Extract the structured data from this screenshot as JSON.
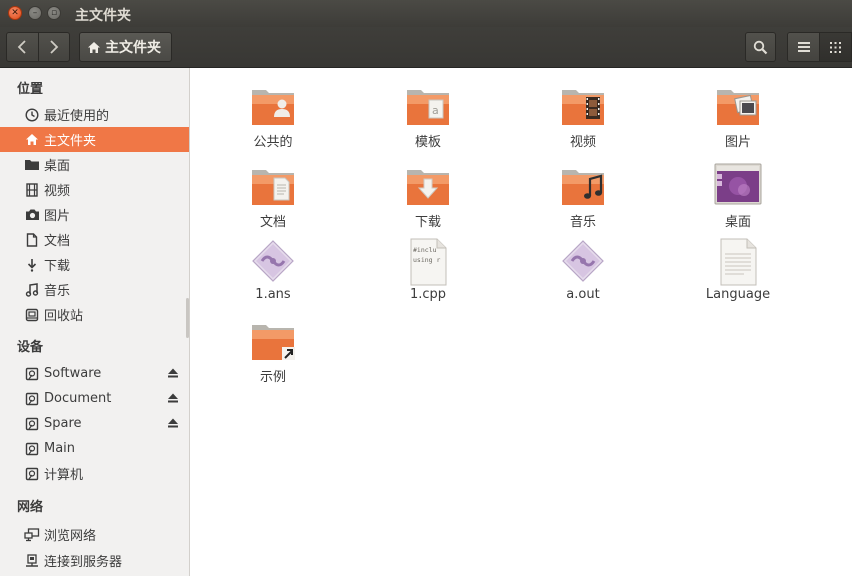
{
  "window": {
    "title": "主文件夹"
  },
  "toolbar": {
    "path_label": "主文件夹"
  },
  "sidebar": {
    "sections": [
      {
        "heading": "位置"
      },
      {
        "heading": "设备"
      },
      {
        "heading": "网络"
      }
    ],
    "places": [
      {
        "label": "最近使用的",
        "icon": "clock-icon"
      },
      {
        "label": "主文件夹",
        "icon": "home-icon"
      },
      {
        "label": "桌面",
        "icon": "desktop-folder-icon"
      },
      {
        "label": "视频",
        "icon": "film-icon"
      },
      {
        "label": "图片",
        "icon": "camera-icon"
      },
      {
        "label": "文档",
        "icon": "document-icon"
      },
      {
        "label": "下载",
        "icon": "download-icon"
      },
      {
        "label": "音乐",
        "icon": "music-icon"
      },
      {
        "label": "回收站",
        "icon": "trash-icon"
      }
    ],
    "devices": [
      {
        "label": "Software",
        "icon": "drive-icon",
        "ejectable": true
      },
      {
        "label": "Document",
        "icon": "drive-icon",
        "ejectable": true
      },
      {
        "label": "Spare",
        "icon": "drive-icon",
        "ejectable": true
      },
      {
        "label": "Main",
        "icon": "drive-icon",
        "ejectable": false
      },
      {
        "label": "计算机",
        "icon": "drive-icon",
        "ejectable": false
      }
    ],
    "network": [
      {
        "label": "浏览网络",
        "icon": "network-icon"
      },
      {
        "label": "连接到服务器",
        "icon": "server-icon"
      }
    ]
  },
  "files": [
    {
      "label": "公共的",
      "icon": "public-folder-icon"
    },
    {
      "label": "模板",
      "icon": "templates-folder-icon"
    },
    {
      "label": "视频",
      "icon": "videos-folder-icon"
    },
    {
      "label": "图片",
      "icon": "pictures-folder-icon"
    },
    {
      "label": "文档",
      "icon": "documents-folder-icon"
    },
    {
      "label": "下载",
      "icon": "downloads-folder-icon"
    },
    {
      "label": "音乐",
      "icon": "music-folder-icon"
    },
    {
      "label": "桌面",
      "icon": "desktop-folder-icon"
    },
    {
      "label": "1.ans",
      "icon": "executable-icon"
    },
    {
      "label": "1.cpp",
      "icon": "cpp-source-icon",
      "preview": [
        "#inclu",
        "using r"
      ]
    },
    {
      "label": "a.out",
      "icon": "executable-icon"
    },
    {
      "label": "Language",
      "icon": "text-file-icon"
    },
    {
      "label": "示例",
      "icon": "examples-folder-link-icon"
    }
  ],
  "colors": {
    "accent": "#f07746",
    "titlebar": "#3d3c38",
    "folder": "#e9743c"
  }
}
